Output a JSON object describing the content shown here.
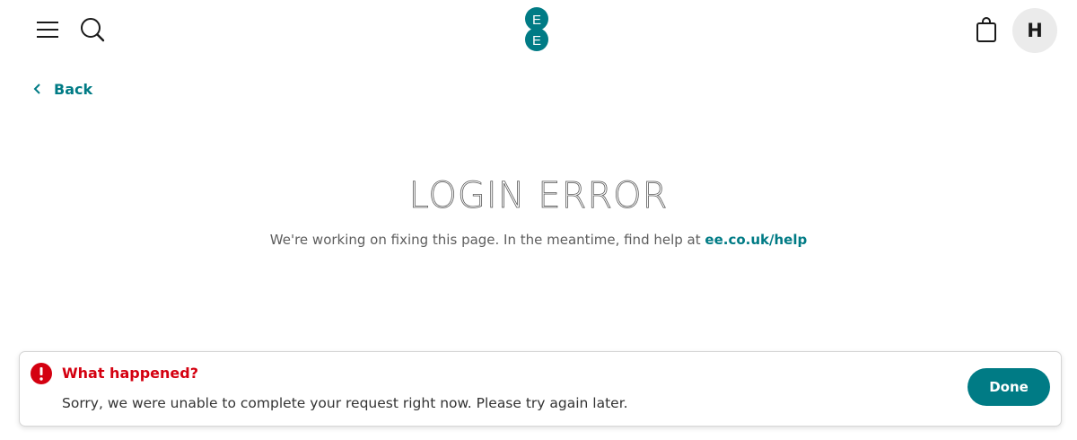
{
  "header": {
    "menu_icon": "hamburger-menu-icon",
    "search_icon": "search-icon",
    "logo_text_top": "E",
    "logo_text_bottom": "E",
    "bag_icon": "shopping-bag-icon",
    "avatar_initial": "H",
    "brand_color": "#007b85"
  },
  "nav": {
    "back_label": "Back"
  },
  "main": {
    "title": "LOGIN ERROR",
    "message": "We're working on fixing this page. In the meantime, find help at",
    "help_link": "ee.co.uk/help"
  },
  "toast": {
    "icon": "alert-icon",
    "title": "What happened?",
    "message": "Sorry, we were unable to complete your request right now. Please try again later.",
    "done_label": "Done",
    "alert_color": "#d40010"
  }
}
